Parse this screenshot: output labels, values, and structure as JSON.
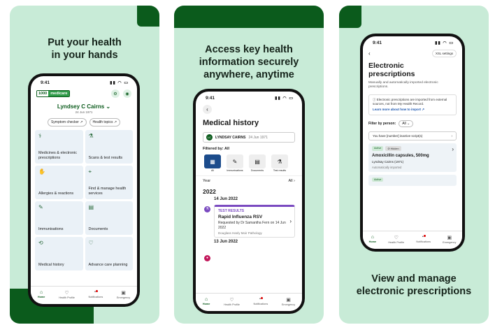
{
  "panel1": {
    "headline_line1": "Put your health",
    "headline_line2": "in your hands",
    "status_time": "9:41",
    "logo_left": "1000",
    "logo_right": "medicare",
    "patient_name": "Lyndsey C Cairns",
    "patient_dob": "24 Jun 1971",
    "pills": [
      "Symptom checker",
      "Health topics"
    ],
    "tiles": [
      {
        "label": "Medicines & electronic prescriptions",
        "icon": "pills-icon"
      },
      {
        "label": "Scans & test results",
        "icon": "test-tube-icon"
      },
      {
        "label": "Allergies & reactions",
        "icon": "hand-icon"
      },
      {
        "label": "Find & manage health services",
        "icon": "location-icon"
      },
      {
        "label": "Immunisations",
        "icon": "syringe-icon"
      },
      {
        "label": "Documents",
        "icon": "document-icon"
      },
      {
        "label": "Medical history",
        "icon": "history-icon"
      },
      {
        "label": "Advance care planning",
        "icon": "care-icon"
      }
    ],
    "nav": [
      "Home",
      "Health Profile",
      "Notifications",
      "Emergency"
    ]
  },
  "panel2": {
    "headline_line1": "Access key health",
    "headline_line2": "information securely",
    "headline_line3": "anywhere, anytime",
    "status_time": "9:41",
    "title": "Medical history",
    "patient_initials": "LC",
    "patient_name": "LYNDSAY CAIRNS",
    "patient_dob": "24 Jun 1971",
    "filtered_by": "Filtered by: All",
    "categories": [
      "All",
      "Immunisations",
      "Documents",
      "Test results"
    ],
    "year_label": "Year",
    "year_filter": "All",
    "year": "2022",
    "date1": "14 Jun 2022",
    "card_type": "TEST RESULTS",
    "card_name": "Rapid Influenza RSV",
    "card_requested": "Requested by Dr Samantha Fern on 14 Jun 2022",
    "card_source": "Douglass Hanly Moir Pathology",
    "date2": "13 Jun 2022",
    "nav": [
      "Home",
      "Health Profile",
      "Notifications",
      "Emergency"
    ]
  },
  "panel3": {
    "headline_line1": "View and manage",
    "headline_line2": "electronic prescriptions",
    "status_time": "9:41",
    "xsl_button": "XSL settings",
    "title_line1": "Electronic",
    "title_line2": "prescriptions",
    "subtitle": "Manually and automatically imported electronic prescriptions.",
    "info_text": "Electronic prescriptions are imported from external sources, not from My Health Record.",
    "info_link": "Learn more about how to import",
    "filter_label": "Filter by person:",
    "filter_value": "All",
    "inactive_text": "You have [number] inactive script(s)",
    "rx_tag_active": "Active",
    "rx_tag_hidden": "Hidden",
    "rx_name": "Amoxicillin capsules, 500mg",
    "rx_person": "Lyndsay Cairns (1971)",
    "rx_import": "Automatically imported",
    "rx2_tag": "Active",
    "nav": [
      "Home",
      "Health Profile",
      "Notifications",
      "Emergency"
    ]
  }
}
